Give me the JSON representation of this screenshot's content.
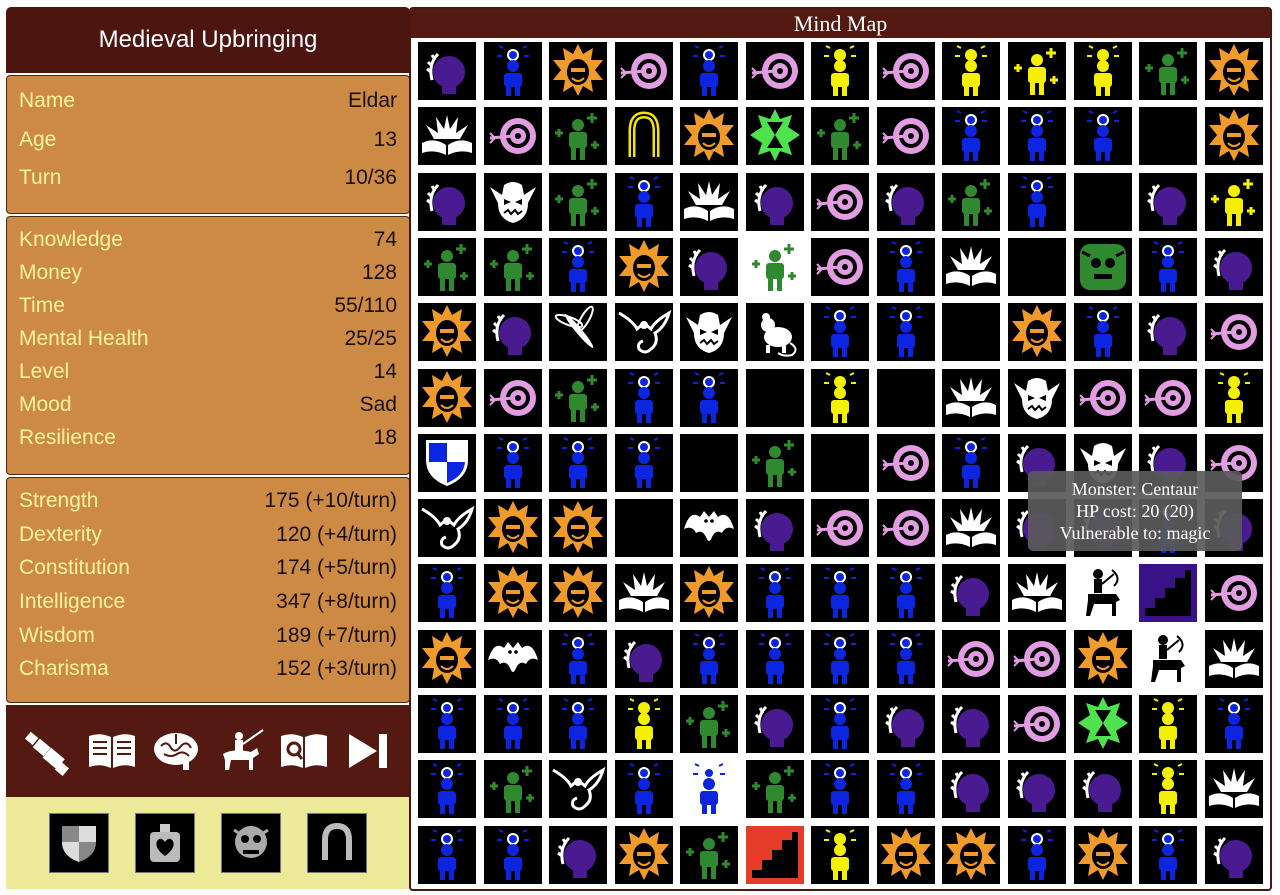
{
  "game_title": "Medieval Upbringing",
  "map_title": "Mind Map",
  "basic_stats": [
    {
      "label": "Name",
      "value": "Eldar"
    },
    {
      "label": "Age",
      "value": "13"
    },
    {
      "label": "Turn",
      "value": "10/36"
    }
  ],
  "status_stats": [
    {
      "label": "Knowledge",
      "value": "74"
    },
    {
      "label": "Money",
      "value": "128"
    },
    {
      "label": "Time",
      "value": "55/110"
    },
    {
      "label": "Mental Health",
      "value": "25/25"
    },
    {
      "label": "Level",
      "value": "14"
    },
    {
      "label": "Mood",
      "value": "Sad"
    },
    {
      "label": "Resilience",
      "value": "18"
    }
  ],
  "attributes": [
    {
      "label": "Strength",
      "value": "175 (+10/turn)"
    },
    {
      "label": "Dexterity",
      "value": "120 (+4/turn)"
    },
    {
      "label": "Constitution",
      "value": "174 (+5/turn)"
    },
    {
      "label": "Intelligence",
      "value": "347 (+8/turn)"
    },
    {
      "label": "Wisdom",
      "value": "189 (+7/turn)"
    },
    {
      "label": "Charisma",
      "value": "152 (+3/turn)"
    }
  ],
  "actions": [
    "spyglass-icon",
    "open-book-icon",
    "brain-icon",
    "knight-horse-icon",
    "book-search-icon",
    "next-turn-icon"
  ],
  "items": [
    "shield-icon",
    "potion-icon",
    "troll-icon",
    "horseshoe-icon"
  ],
  "tooltip": {
    "line1": "Monster: Centaur",
    "line2": "HP cost: 20 (20)",
    "line3": "Vulnerable to: magic"
  },
  "legend": {
    "L": "laurel-head-icon",
    "B": "lightbulb-person-icon",
    "S": "sun-face-icon",
    "T": "target-icon",
    "Y": "idea-person-yellow-icon",
    "H": "healing-person-icon",
    "K": "sparkle-person-icon",
    "W": "open-book-icon",
    "O": "horseshoe-icon",
    "G": "hourglass-icon",
    "M": "goblin-face-icon",
    "D": "dragonfly-icon",
    "F": "wyvern-icon",
    "R": "rat-icon",
    "Q": "shield-icon",
    "V": "bat-icon",
    "C": "centaur-icon",
    "X": "stairs-icon",
    "E": "empty-cell",
    "A": "troll-icon"
  },
  "grid": [
    [
      "L",
      "B",
      "S",
      "T",
      "B",
      "T",
      "Y",
      "T",
      "Y",
      "K",
      "Y",
      "H",
      "S"
    ],
    [
      "W",
      "T",
      "H",
      "O",
      "S",
      "G",
      "H",
      "T",
      "B",
      "B",
      "B",
      "E",
      "S"
    ],
    [
      "L",
      "M",
      "H",
      "B",
      "W",
      "L",
      "T",
      "L",
      "H",
      "B",
      "E",
      "L",
      "K"
    ],
    [
      "H",
      "H",
      "B",
      "S",
      "L",
      "H",
      "T",
      "B",
      "W",
      "E",
      "A",
      "B",
      "L"
    ],
    [
      "S",
      "L",
      "D",
      "F",
      "M",
      "R",
      "B",
      "B",
      "E",
      "S",
      "B",
      "L",
      "T"
    ],
    [
      "S",
      "T",
      "H",
      "B",
      "B",
      "E",
      "Y",
      "E",
      "W",
      "M",
      "T",
      "T",
      "Y"
    ],
    [
      "Q",
      "B",
      "B",
      "B",
      "E",
      "H",
      "E",
      "T",
      "B",
      "L",
      "M",
      "L",
      "T"
    ],
    [
      "F",
      "S",
      "S",
      "E",
      "V",
      "L",
      "T",
      "T",
      "W",
      "L",
      "L",
      "B",
      "L"
    ],
    [
      "B",
      "S",
      "S",
      "W",
      "S",
      "B",
      "B",
      "B",
      "L",
      "W",
      "C",
      "X",
      "T"
    ],
    [
      "S",
      "V",
      "B",
      "L",
      "B",
      "B",
      "B",
      "B",
      "T",
      "T",
      "S",
      "C",
      "W"
    ],
    [
      "B",
      "B",
      "B",
      "Y",
      "H",
      "L",
      "B",
      "L",
      "L",
      "T",
      "G",
      "Y",
      "B"
    ],
    [
      "B",
      "H",
      "F",
      "B",
      "B",
      "H",
      "B",
      "B",
      "L",
      "L",
      "L",
      "Y",
      "W"
    ],
    [
      "B",
      "B",
      "L",
      "S",
      "H",
      "X",
      "Y",
      "S",
      "S",
      "B",
      "S",
      "B",
      "L"
    ]
  ]
}
